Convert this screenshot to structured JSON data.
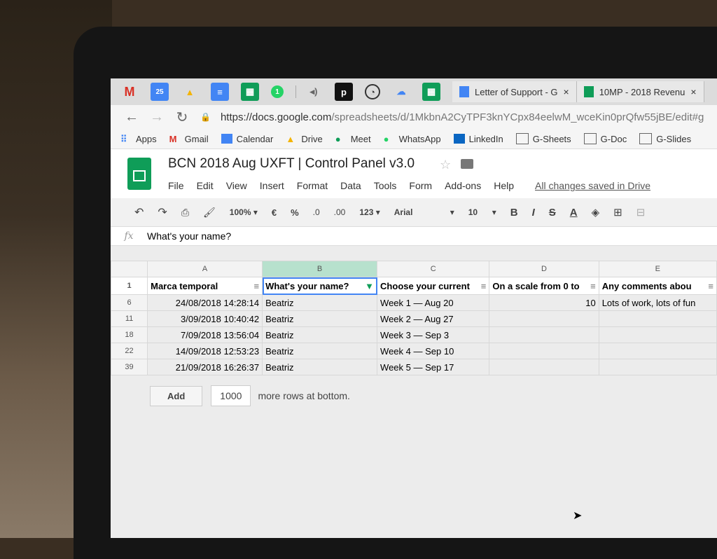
{
  "browser": {
    "tab_icons": [
      "gmail-icon",
      "calendar-icon",
      "drive-icon",
      "docs-icon",
      "sheets-icon",
      "whatsapp-icon",
      "audio-icon",
      "pocket-icon",
      "clock-icon",
      "cloud-icon",
      "sheets-icon"
    ],
    "calendar_day": "25",
    "tabs": [
      {
        "title": "Letter of Support - G",
        "close": "×"
      },
      {
        "title": "10MP - 2018 Revenu",
        "close": "×"
      }
    ],
    "url_host": "https://docs.google.com",
    "url_path": "/spreadsheets/d/1MkbnA2CyTPF3knYCpx84eelwM_wceKin0prQfw55jBE/edit#g",
    "bookmarks": [
      {
        "label": "Apps",
        "icon": "apps-grid-icon"
      },
      {
        "label": "Gmail",
        "icon": "gmail-icon"
      },
      {
        "label": "Calendar",
        "icon": "calendar-icon"
      },
      {
        "label": "Drive",
        "icon": "drive-icon"
      },
      {
        "label": "Meet",
        "icon": "meet-icon"
      },
      {
        "label": "WhatsApp",
        "icon": "whatsapp-icon"
      },
      {
        "label": "LinkedIn",
        "icon": "linkedin-icon"
      },
      {
        "label": "G-Sheets",
        "icon": "folder-icon"
      },
      {
        "label": "G-Doc",
        "icon": "folder-icon"
      },
      {
        "label": "G-Slides",
        "icon": "folder-icon"
      }
    ]
  },
  "doc": {
    "title": "BCN 2018 Aug UXFT | Control Panel v3.0",
    "menu": [
      "File",
      "Edit",
      "View",
      "Insert",
      "Format",
      "Data",
      "Tools",
      "Form",
      "Add-ons",
      "Help"
    ],
    "saved_status": "All changes saved in Drive"
  },
  "toolbar": {
    "zoom": "100%",
    "currency": "€",
    "percent": "%",
    "dec_less": ".0",
    "dec_more": ".00",
    "format_more": "123",
    "font": "Arial",
    "font_size": "10",
    "bold": "B",
    "italic": "I",
    "strike": "S",
    "text_color": "A"
  },
  "formula_bar": {
    "fx": "fx",
    "value": "What's your name?"
  },
  "sheet": {
    "columns": [
      "A",
      "B",
      "C",
      "D",
      "E"
    ],
    "header_row_num": "1",
    "headers": [
      "Marca temporal",
      "What's your name?",
      "Choose your current",
      "On a scale from 0 to",
      "Any comments abou"
    ],
    "rows": [
      {
        "num": "6",
        "a": "24/08/2018 14:28:14",
        "b": "Beatriz",
        "c": "Week 1 — Aug 20",
        "d": "10",
        "e": "Lots of work, lots of fun"
      },
      {
        "num": "11",
        "a": "3/09/2018 10:40:42",
        "b": "Beatriz",
        "c": "Week 2 — Aug 27",
        "d": "",
        "e": ""
      },
      {
        "num": "18",
        "a": "7/09/2018 13:56:04",
        "b": "Beatriz",
        "c": "Week 3 — Sep 3",
        "d": "",
        "e": ""
      },
      {
        "num": "22",
        "a": "14/09/2018 12:53:23",
        "b": "Beatriz",
        "c": "Week 4 — Sep 10",
        "d": "",
        "e": ""
      },
      {
        "num": "39",
        "a": "21/09/2018 16:26:37",
        "b": "Beatriz",
        "c": "Week 5 — Sep 17",
        "d": "",
        "e": ""
      }
    ],
    "add_label": "Add",
    "add_rows_value": "1000",
    "add_rows_suffix": "more rows at bottom."
  },
  "colors": {
    "sheets_green": "#0f9d58",
    "selected_col": "#b7e1cd",
    "active_cell": "#4285f4"
  }
}
